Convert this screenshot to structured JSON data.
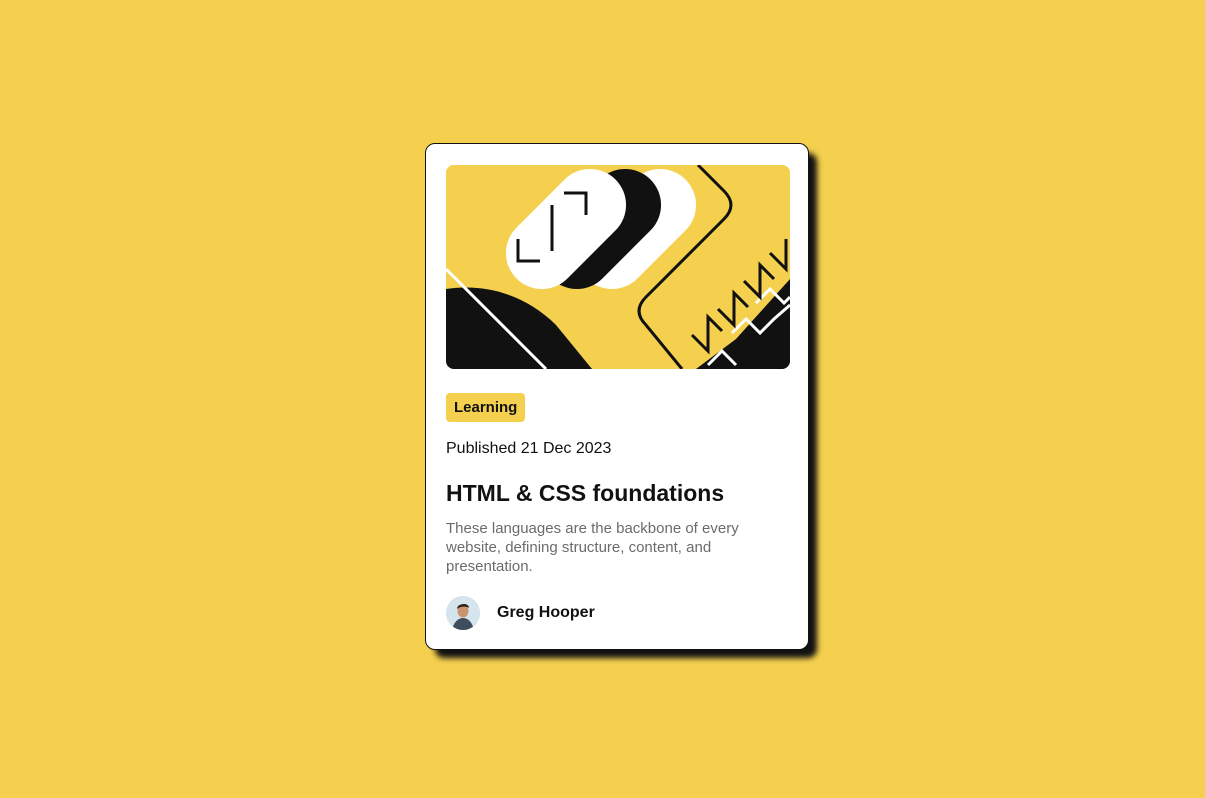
{
  "page": {
    "background_color": "#F4D04E"
  },
  "card": {
    "illustration": {
      "description_icon": "abstract-illustration",
      "accent_color": "#F4D04E",
      "dark_color": "#111111"
    },
    "tag": "Learning",
    "published": "Published 21 Dec 2023",
    "title": "HTML & CSS foundations",
    "description": "These languages are the backbone of every website, defining structure, content, and presentation.",
    "author": {
      "name": "Greg Hooper",
      "avatar_icon": "author-avatar"
    }
  }
}
